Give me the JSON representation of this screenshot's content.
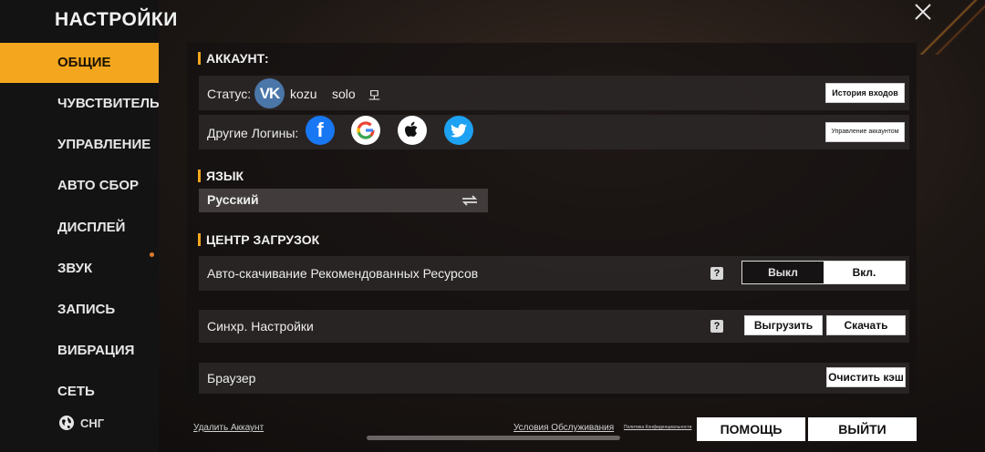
{
  "sidebar": {
    "title": "НАСТРОЙКИ",
    "items": [
      {
        "label": "ОБЩИЕ",
        "active": true
      },
      {
        "label": "ЧУВСТВИТЕЛЬНО"
      },
      {
        "label": "УПРАВЛЕНИЕ"
      },
      {
        "label": "АВТО СБОР"
      },
      {
        "label": "ДИСПЛЕЙ"
      },
      {
        "label": "ЗВУК"
      },
      {
        "label": "ЗАПИСЬ"
      },
      {
        "label": "ВИБРАЦИЯ"
      },
      {
        "label": "СЕТЬ"
      }
    ],
    "region_label": "СНГ",
    "accent_color": "#f4a71e"
  },
  "account": {
    "section_title": "АККАУНТ:",
    "status_label": "Статус:",
    "status_name": "kozu",
    "status_extra": "solo",
    "status_symbol": "모",
    "history_button": "История входов",
    "other_logins_label": "Другие Логины:",
    "manage_button": "Управление аккаунтом",
    "logins": [
      "facebook-icon",
      "google-icon",
      "apple-icon",
      "twitter-icon"
    ]
  },
  "language": {
    "section_title": "ЯЗЫК",
    "current": "Русский"
  },
  "downloads": {
    "section_title": "ЦЕНТР ЗАГРУЗОК",
    "auto_download_label": "Авто-скачивание Рекомендованных Ресурсов",
    "help": "?",
    "toggle_off": "Выкл",
    "toggle_on": "Вкл.",
    "sync_label": "Синхр. Настройки",
    "upload_button": "Выгрузить",
    "download_button": "Скачать",
    "browser_label": "Браузер",
    "clear_cache_button": "Очистить кэш"
  },
  "footer": {
    "delete_account": "Удалить Аккаунт",
    "terms": "Условия Обслуживания",
    "privacy": "Политика Конфиденциальности",
    "help_button": "ПОМОЩЬ",
    "logout_button": "ВЫЙТИ"
  }
}
